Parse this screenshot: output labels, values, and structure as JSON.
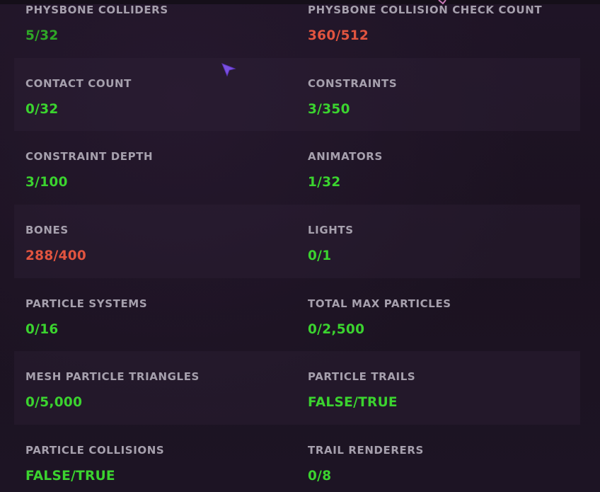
{
  "colors": {
    "background": "#1c1322",
    "label": "#a6a0ad",
    "ok": "#3bd32f",
    "bad": "#e2543f",
    "cursor": "#7a4fe0"
  },
  "stats": [
    {
      "label": "PHYSBONE COLLIDERS",
      "value": "5/32",
      "status": "ok"
    },
    {
      "label": "PHYSBONE COLLISION CHECK COUNT",
      "value": "360/512",
      "status": "bad"
    },
    {
      "label": "CONTACT COUNT",
      "value": "0/32",
      "status": "ok"
    },
    {
      "label": "CONSTRAINTS",
      "value": "3/350",
      "status": "ok"
    },
    {
      "label": "CONSTRAINT DEPTH",
      "value": "3/100",
      "status": "ok"
    },
    {
      "label": "ANIMATORS",
      "value": "1/32",
      "status": "ok"
    },
    {
      "label": "BONES",
      "value": "288/400",
      "status": "bad"
    },
    {
      "label": "LIGHTS",
      "value": "0/1",
      "status": "ok"
    },
    {
      "label": "PARTICLE SYSTEMS",
      "value": "0/16",
      "status": "ok"
    },
    {
      "label": "TOTAL MAX PARTICLES",
      "value": "0/2,500",
      "status": "ok"
    },
    {
      "label": "MESH PARTICLE TRIANGLES",
      "value": "0/5,000",
      "status": "ok"
    },
    {
      "label": "PARTICLE TRAILS",
      "value": "FALSE/TRUE",
      "status": "ok"
    },
    {
      "label": "PARTICLE COLLISIONS",
      "value": "FALSE/TRUE",
      "status": "ok"
    },
    {
      "label": "TRAIL RENDERERS",
      "value": "0/8",
      "status": "ok"
    }
  ],
  "cursor": {
    "icon": "mouse-pointer-icon"
  }
}
